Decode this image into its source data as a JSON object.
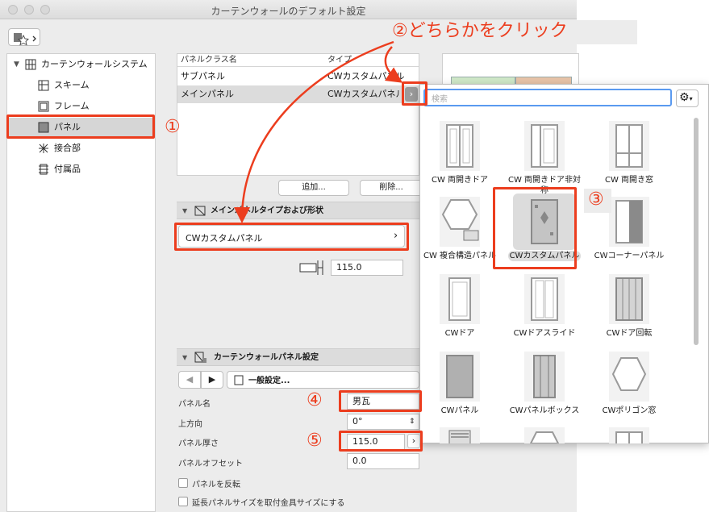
{
  "window": {
    "title": "カーテンウォールのデフォルト設定"
  },
  "sidebar": {
    "items": [
      {
        "label": "カーテンウォールシステム",
        "icon": "grid-icon"
      },
      {
        "label": "スキーム",
        "icon": "scheme-icon"
      },
      {
        "label": "フレーム",
        "icon": "frame-icon"
      },
      {
        "label": "パネル",
        "icon": "panel-icon"
      },
      {
        "label": "接合部",
        "icon": "junction-icon"
      },
      {
        "label": "付属品",
        "icon": "accessory-icon"
      }
    ]
  },
  "panel_table": {
    "columns": [
      "パネルクラス名",
      "タイプ"
    ],
    "rows": [
      {
        "name": "サブパネル",
        "type": "CWカスタムパネル"
      },
      {
        "name": "メインパネル",
        "type": "CWカスタムパネル"
      }
    ],
    "add_label": "追加...",
    "delete_label": "削除..."
  },
  "type_section": {
    "title": "メインパネルタイプおよび形状",
    "selected_type": "CWカスタムパネル",
    "thickness": "115.0"
  },
  "settings_section": {
    "title": "カーテンウォールパネル設定",
    "page_label": "一般設定...",
    "fields": [
      {
        "label": "パネル名",
        "value": "男瓦"
      },
      {
        "label": "上方向",
        "value": "0°"
      },
      {
        "label": "パネル厚さ",
        "value": "115.0"
      },
      {
        "label": "パネルオフセット",
        "value": "0.0"
      }
    ],
    "checkboxes": [
      {
        "label": "パネルを反転",
        "checked": false
      },
      {
        "label": "延長パネルサイズを取付金具サイズにする",
        "checked": false
      }
    ]
  },
  "popup": {
    "search_placeholder": "検索",
    "items": [
      {
        "label": "CW 両開きドア"
      },
      {
        "label": "CW 両開きドア非対称"
      },
      {
        "label": "CW 両開き窓"
      },
      {
        "label": "CW 複合構造パネル"
      },
      {
        "label": "CWカスタムパネル",
        "selected": true
      },
      {
        "label": "CWコーナーパネル"
      },
      {
        "label": "CWドア"
      },
      {
        "label": "CWドアスライド"
      },
      {
        "label": "CWドア回転"
      },
      {
        "label": "CWパネル"
      },
      {
        "label": "CWパネルボックス"
      },
      {
        "label": "CWポリゴン窓"
      }
    ]
  },
  "annotations": {
    "step1": "①",
    "step2": "②どちらかをクリック",
    "step3": "③",
    "step4": "④",
    "step5": "⑤",
    "color": "#ec3d1e"
  }
}
